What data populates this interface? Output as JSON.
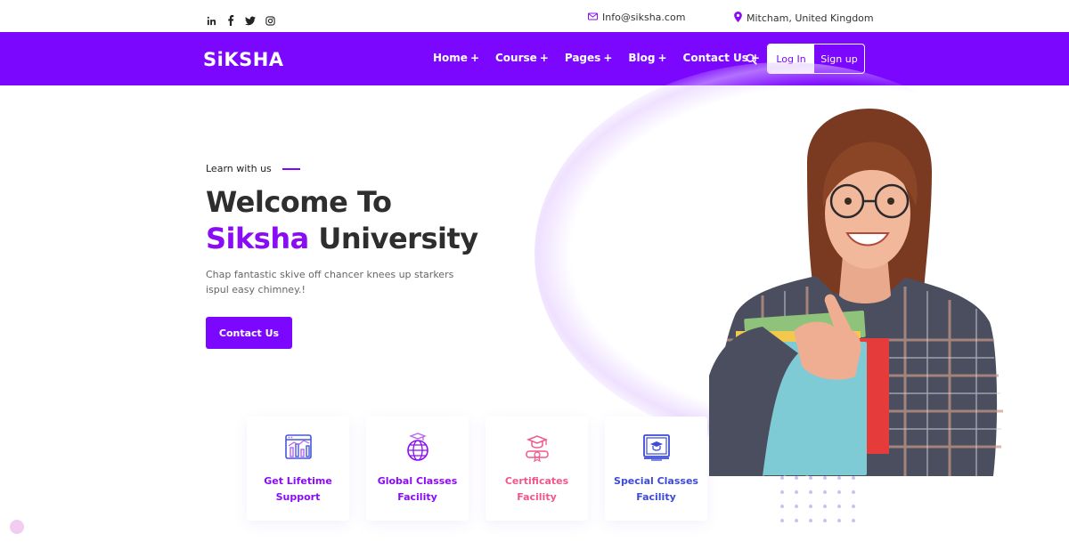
{
  "topbar": {
    "social_icons": [
      "linkedin-icon",
      "facebook-icon",
      "twitter-icon",
      "instagram-icon"
    ],
    "email": "Info@siksha.com",
    "location": "Mitcham, United Kingdom"
  },
  "header": {
    "logo": "SiKSHA",
    "nav": [
      {
        "label": "Home"
      },
      {
        "label": "Course"
      },
      {
        "label": "Pages"
      },
      {
        "label": "Blog"
      },
      {
        "label": "Contact Us"
      }
    ],
    "nav_plus": "+",
    "login_label": "Log In",
    "signup_label": "Sign up"
  },
  "hero": {
    "eyebrow": "Learn with us",
    "title_line1": "Welcome To",
    "title_brand": "Siksha",
    "title_rest": "University",
    "description": "Chap fantastic skive off chancer knees up starkers ispul easy chimney.!",
    "cta_label": "Contact Us"
  },
  "features": [
    {
      "line1": "Get Lifetime",
      "line2": "Support",
      "icon": "support-chart-icon",
      "color": "#8a0cf5"
    },
    {
      "line1": "Global Classes",
      "line2": "Facility",
      "icon": "globe-icon",
      "color": "#8a0cf5"
    },
    {
      "line1": "Certificates",
      "line2": "Facility",
      "icon": "certificate-icon",
      "color": "#f0588a"
    },
    {
      "line1": "Special Classes",
      "line2": "Facility",
      "icon": "classroom-board-icon",
      "color": "#3d4bd6"
    }
  ],
  "colors": {
    "brand": "#7b07ff",
    "accent_purple": "#8a0cf5",
    "accent_pink": "#f0588a",
    "accent_blue": "#3d4bd6"
  }
}
